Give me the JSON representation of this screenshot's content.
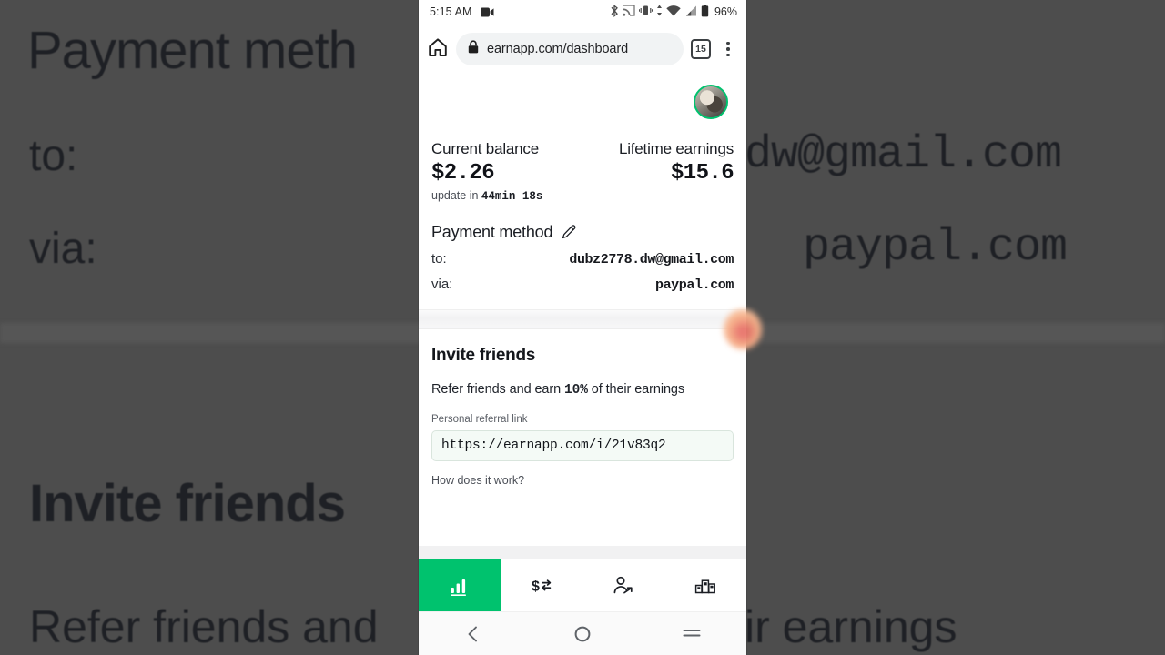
{
  "background": {
    "payment_title": "Payment meth",
    "to_label": "to:",
    "via_label": "via:",
    "email_fragment": "dw@gmail.com",
    "paypal_fragment": "paypal.com",
    "invite_title": "Invite friends",
    "refer_left": "Refer friends and",
    "refer_right": "ir earnings"
  },
  "statusbar": {
    "clock": "5:15 AM",
    "battery_percent": "96%",
    "icons": [
      "screen-record-icon",
      "bluetooth-icon",
      "cast-icon",
      "vibrate-icon",
      "data-transfer-icon",
      "wifi-icon",
      "signal-icon",
      "battery-icon"
    ]
  },
  "browser": {
    "home_icon": "home-icon",
    "lock_icon": "lock-icon",
    "url": "earnapp.com/dashboard",
    "tab_count": "15",
    "menu_icon": "kebab-menu-icon"
  },
  "account": {
    "avatar_label": "User avatar",
    "avatar_ring_color": "#00c26e"
  },
  "balances": {
    "current": {
      "label": "Current balance",
      "value": "$2.26",
      "update_prefix": "update in ",
      "update_timer": "44min 18s"
    },
    "lifetime": {
      "label": "Lifetime earnings",
      "value": "$15.6"
    }
  },
  "payment_method": {
    "title": "Payment method",
    "edit_icon": "pencil-edit-icon",
    "rows": [
      {
        "key": "to:",
        "value": "dubz2778.dw@gmail.com"
      },
      {
        "key": "via:",
        "value": "paypal.com"
      }
    ]
  },
  "invite": {
    "title": "Invite friends",
    "subtitle_pre": "Refer friends and earn ",
    "subtitle_bold": "10%",
    "subtitle_post": " of their earnings",
    "field_label": "Personal referral link",
    "referral_link": "https://earnapp.com/i/21v83q2",
    "how_link": "How does it work?"
  },
  "tabbar": {
    "active_color": "#00c26e",
    "items": [
      {
        "name": "stats",
        "icon": "bar-chart-icon",
        "active": true
      },
      {
        "name": "transactions",
        "icon": "dollar-exchange-icon",
        "active": false
      },
      {
        "name": "referrals",
        "icon": "person-share-icon",
        "active": false
      },
      {
        "name": "devices",
        "icon": "devices-podium-icon",
        "active": false
      }
    ]
  },
  "navbar": {
    "back_icon": "back-chevron-icon",
    "home_icon": "home-circle-icon",
    "recents_icon": "recents-menu-icon"
  },
  "overlay": {
    "finger_label": "finger-touch-blob"
  }
}
